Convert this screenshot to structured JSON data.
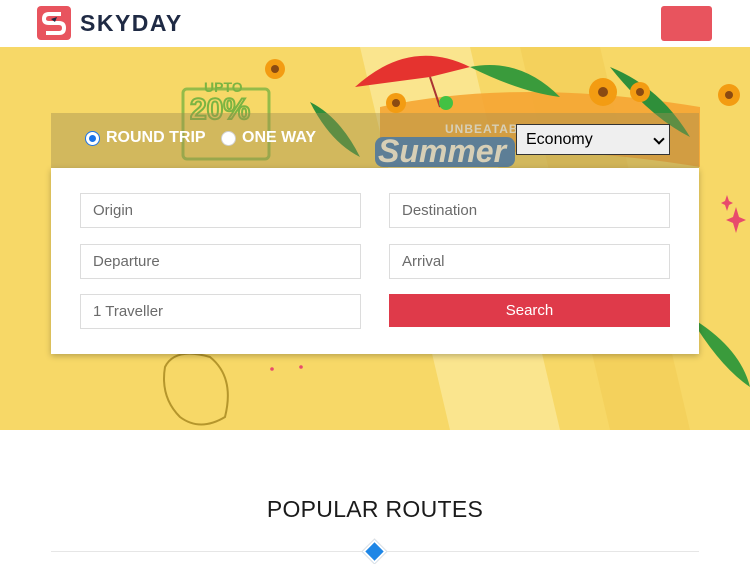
{
  "header": {
    "brand": "SKYDAY",
    "logo_icon": "skyday-logo-icon",
    "menu_icon": "menu-toggle-icon",
    "accent_color": "#e8545e"
  },
  "hero": {
    "promo": {
      "upto": "UPTO",
      "percent": "20%",
      "tag": "UNBEATABLE",
      "headline": "Summer"
    },
    "trip_type": {
      "options": [
        "ROUND TRIP",
        "ONE WAY"
      ],
      "selected": "ROUND TRIP"
    },
    "cabin_class": "Economy"
  },
  "search_form": {
    "origin_placeholder": "Origin",
    "destination_placeholder": "Destination",
    "departure_placeholder": "Departure",
    "arrival_placeholder": "Arrival",
    "travellers_placeholder": "1 Traveller",
    "search_label": "Search",
    "search_color": "#df3a4a"
  },
  "popular_routes": {
    "title": "POPULAR ROUTES",
    "divider_icon": "diamond-icon"
  }
}
